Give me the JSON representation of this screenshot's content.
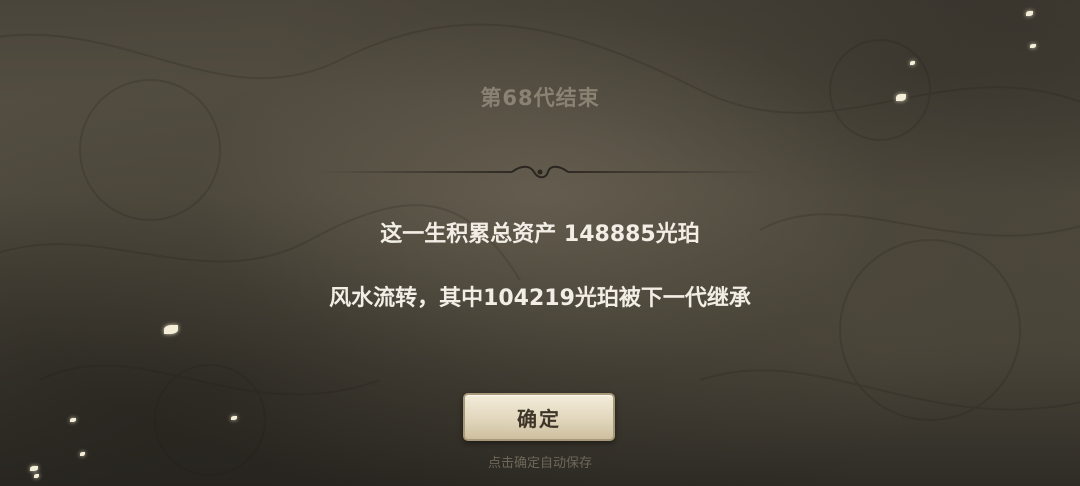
{
  "dialog": {
    "title": "第68代结束",
    "summary_line": "这一生积累总资产 148885光珀",
    "inherit_line": "风水流转，其中104219光珀被下一代继承",
    "confirm_label": "确定",
    "hint": "点击确定自动保存"
  },
  "colors": {
    "title": "#8a8272",
    "body_text": "#f2eee6",
    "button_face": "#e2d7bd",
    "button_text": "#3d3528",
    "hint": "#6e6759"
  },
  "decor": {
    "divider_icon": "ornate-divider-icon",
    "particles": "light-petal-icon"
  }
}
